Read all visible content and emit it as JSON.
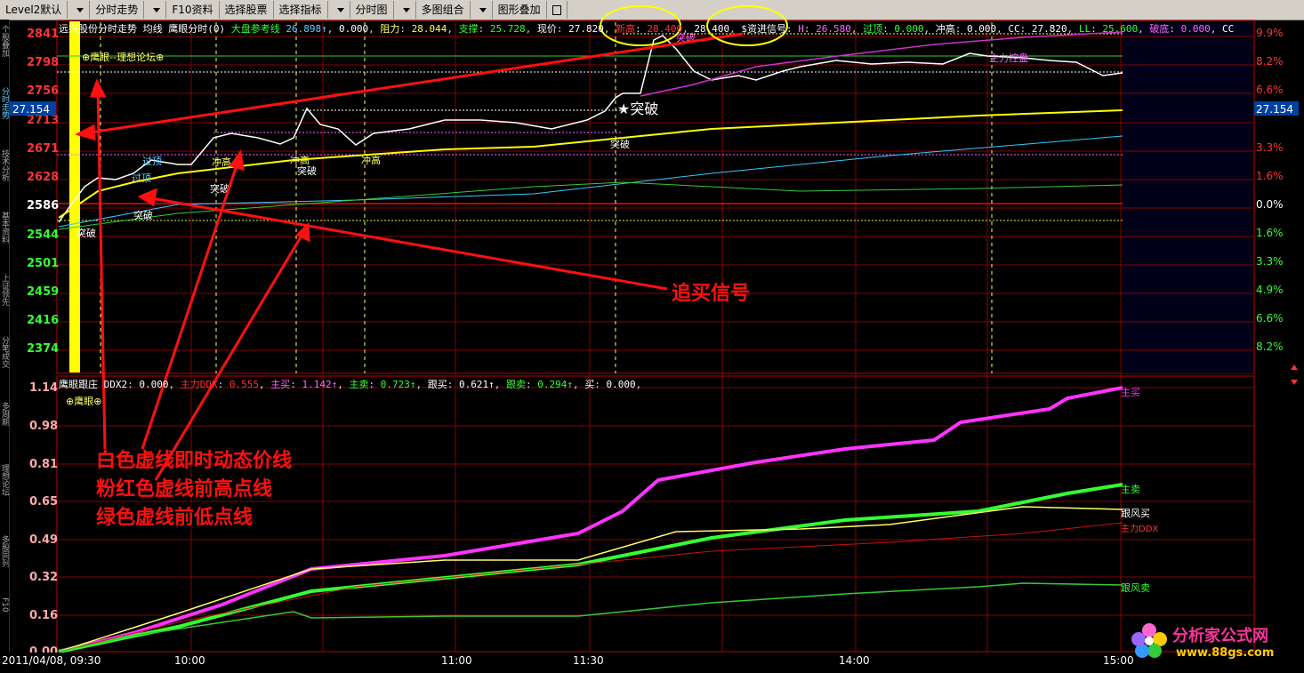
{
  "toolbar": {
    "items": [
      "Level2默认",
      "分时走势",
      "F10资料",
      "选择股票",
      "选择指标",
      "分时图",
      "多图组合",
      "图形叠加"
    ]
  },
  "side_tabs": [
    "个股叠加",
    "分时走势",
    "技术分析",
    "基本资料",
    "上证领先",
    "分笔成交",
    "多周期",
    "理想论坛",
    "多股同列",
    "F10"
  ],
  "header": {
    "title": "远兴股份分时走势",
    "avg": "均线",
    "indicator": "鹰眼分时(0)",
    "ref": "大盘参考线",
    "v1": "26.898↑",
    "v2": "0.000",
    "resist_label": "阻力",
    "resist": "28.044",
    "support_label": "支撑",
    "support": "25.728",
    "price_label": "现价",
    "price": "27.820",
    "high_label": "新高",
    "high": "28.400",
    "high2": "28.400",
    "signal": "$资进信号",
    "h_label": "H",
    "h": "26.580",
    "guoding_label": "过顶",
    "guoding": "0.000",
    "chonggao_label": "冲高",
    "chonggao": "0.000",
    "cc_label": "CC",
    "cc": "27.820",
    "ll_label": "LL",
    "ll": "25.600",
    "podi_label": "破底",
    "podi": "0.000",
    "tail": "CC"
  },
  "price_axis": {
    "left": [
      "2841",
      "2798",
      "2756",
      "2713",
      "2671",
      "2628",
      "2586",
      "2544",
      "2501",
      "2459",
      "2416",
      "2374"
    ],
    "right": [
      "9.9%",
      "8.2%",
      "6.6%",
      "4.9%",
      "3.3%",
      "1.6%",
      "0.0%",
      "1.6%",
      "3.3%",
      "4.9%",
      "6.6%",
      "8.2%"
    ],
    "current_left": "27.154",
    "current_right": "27.154"
  },
  "main_chart": {
    "watermark": "⊕鹰眼--理想论坛⊕",
    "breakout_label": "★突破",
    "markers": [
      "突破",
      "突破",
      "突破",
      "突破",
      "冲高",
      "冲高",
      "冲高",
      "过顶",
      "过顶",
      "突破",
      "突破",
      "主力控盘"
    ],
    "annotation_signal": "追买信号"
  },
  "lower_panel": {
    "title": "鹰眼跟庄",
    "ddx2_label": "DDX2",
    "ddx2": "0.000",
    "zl_ddx_label": "主力DDX",
    "zl_ddx": "0.555",
    "zhumai_label": "主买",
    "zhumai": "1.142↑",
    "zhumai2_label": "主卖",
    "zhumai2": "0.723↑",
    "genmai_label": "跟买",
    "genmai": "0.621↑",
    "genmai2_label": "跟卖",
    "genmai2": "0.294↑",
    "mai_label": "买",
    "mai": "0.000",
    "badge": "⊕鹰眼⊕",
    "axis": [
      "1.14",
      "0.98",
      "0.81",
      "0.65",
      "0.49",
      "0.32",
      "0.16",
      "0.00"
    ],
    "legend": [
      "主买",
      "主卖",
      "跟风买",
      "主力DDX",
      "跟风卖"
    ]
  },
  "annotations": {
    "line1": "白色虚线即时动态价线",
    "line2": "粉红色虚线前高点线",
    "line3": "绿色虚线前低点线"
  },
  "time_axis": {
    "date": "2011/04/08, 09:30",
    "ticks": [
      "10:00",
      "11:00",
      "11:30",
      "14:00",
      "15:00"
    ]
  },
  "logo": {
    "name": "分析家公式网",
    "url": "www.88gs.com"
  },
  "colors": {
    "grid_red": "#c00000",
    "price_white": "#ffffff",
    "avg_yellow": "#ffff00",
    "magenta": "#ff33ff",
    "green": "#33ff33",
    "annotation_red": "#ff1010"
  }
}
